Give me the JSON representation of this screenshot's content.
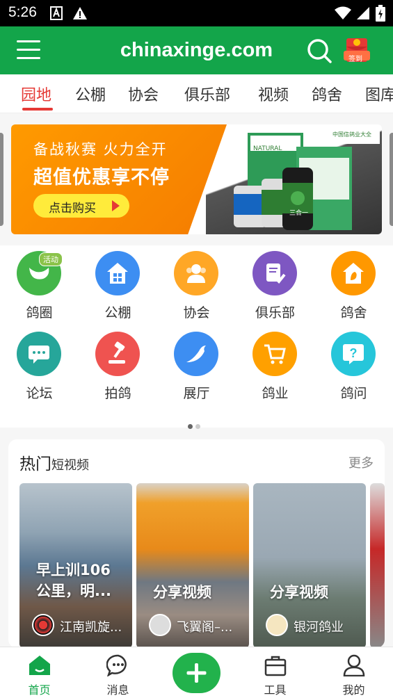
{
  "status_bar": {
    "time": "5:26"
  },
  "header": {
    "title": "chinaxinge.com",
    "sign_label": "签到"
  },
  "tabs": [
    "园地",
    "公棚",
    "协会",
    "俱乐部",
    "视频",
    "鸽舍",
    "图库"
  ],
  "active_tab": 0,
  "banner": {
    "line1": "备战秋赛  火力全开",
    "line2": "超值优惠享不停",
    "button": "点击购买",
    "product_brand": "NATURAL",
    "product_name": "三合一",
    "site_tag": "中国信鸽业大全"
  },
  "grid": {
    "items": [
      {
        "label": "鸽圈",
        "icon": "chat-bird-icon",
        "color": "#43b649",
        "badge": "活动"
      },
      {
        "label": "公棚",
        "icon": "house-icon",
        "color": "#3d8ef2"
      },
      {
        "label": "协会",
        "icon": "people-icon",
        "color": "#ffa726"
      },
      {
        "label": "俱乐部",
        "icon": "document-check-icon",
        "color": "#7e57c2"
      },
      {
        "label": "鸽舍",
        "icon": "home-bird-icon",
        "color": "#ff9800"
      },
      {
        "label": "论坛",
        "icon": "forum-icon",
        "color": "#26a69a"
      },
      {
        "label": "拍鸽",
        "icon": "auction-hammer-icon",
        "color": "#ef5350"
      },
      {
        "label": "展厅",
        "icon": "pigeon-icon",
        "color": "#3d8ef2"
      },
      {
        "label": "鸽业",
        "icon": "cart-icon",
        "color": "#ffa000"
      },
      {
        "label": "鸽问",
        "icon": "question-icon",
        "color": "#26c6da"
      }
    ]
  },
  "hot": {
    "title": "热门",
    "subtitle": "短视频",
    "more": "更多",
    "videos": [
      {
        "title_l1": "早上训106",
        "title_l2": "公里，明...",
        "author": "江南凯旋..."
      },
      {
        "title_l1": "分享视频",
        "title_l2": "",
        "author": "飞翼阁–..."
      },
      {
        "title_l1": "分享视频",
        "title_l2": "",
        "author": "银河鸽业"
      }
    ]
  },
  "bottom_nav": [
    "首页",
    "消息",
    "",
    "工具",
    "我的"
  ],
  "colors": {
    "brand_green": "#13a54a",
    "active_red": "#e53935",
    "banner_orange": "#f57c00"
  }
}
